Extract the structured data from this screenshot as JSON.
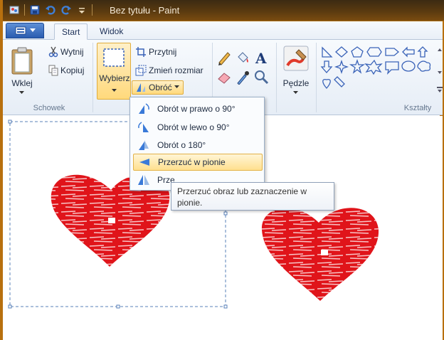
{
  "window": {
    "title": "Bez tytułu - Paint"
  },
  "tabs": [
    {
      "label": "Start",
      "active": true
    },
    {
      "label": "Widok",
      "active": false
    }
  ],
  "clipboard": {
    "paste_label": "Wklej",
    "cut_label": "Wytnij",
    "copy_label": "Kopiuj",
    "group_label": "Schowek"
  },
  "image": {
    "select_label": "Wybierz",
    "crop_label": "Przytnij",
    "resize_label": "Zmień rozmiar",
    "rotate_label": "Obróć"
  },
  "brushes": {
    "label": "Pędzle"
  },
  "shapes": {
    "group_label": "Kształty"
  },
  "rotate_menu": {
    "items": [
      {
        "label": "Obrót w prawo o 90°"
      },
      {
        "label": "Obrót w lewo o 90°"
      },
      {
        "label": "Obrót o 180°"
      },
      {
        "label": "Przerzuć w pionie"
      },
      {
        "label": "Prze"
      }
    ],
    "highlighted_index": 3
  },
  "tooltip": {
    "text": "Przerzuć obraz lub zaznaczenie w pionie."
  },
  "colors": {
    "heart": "#e0141a",
    "selection": "#5a80b8",
    "title_bar": "#5a3a10",
    "highlight": "#ffe08f"
  }
}
